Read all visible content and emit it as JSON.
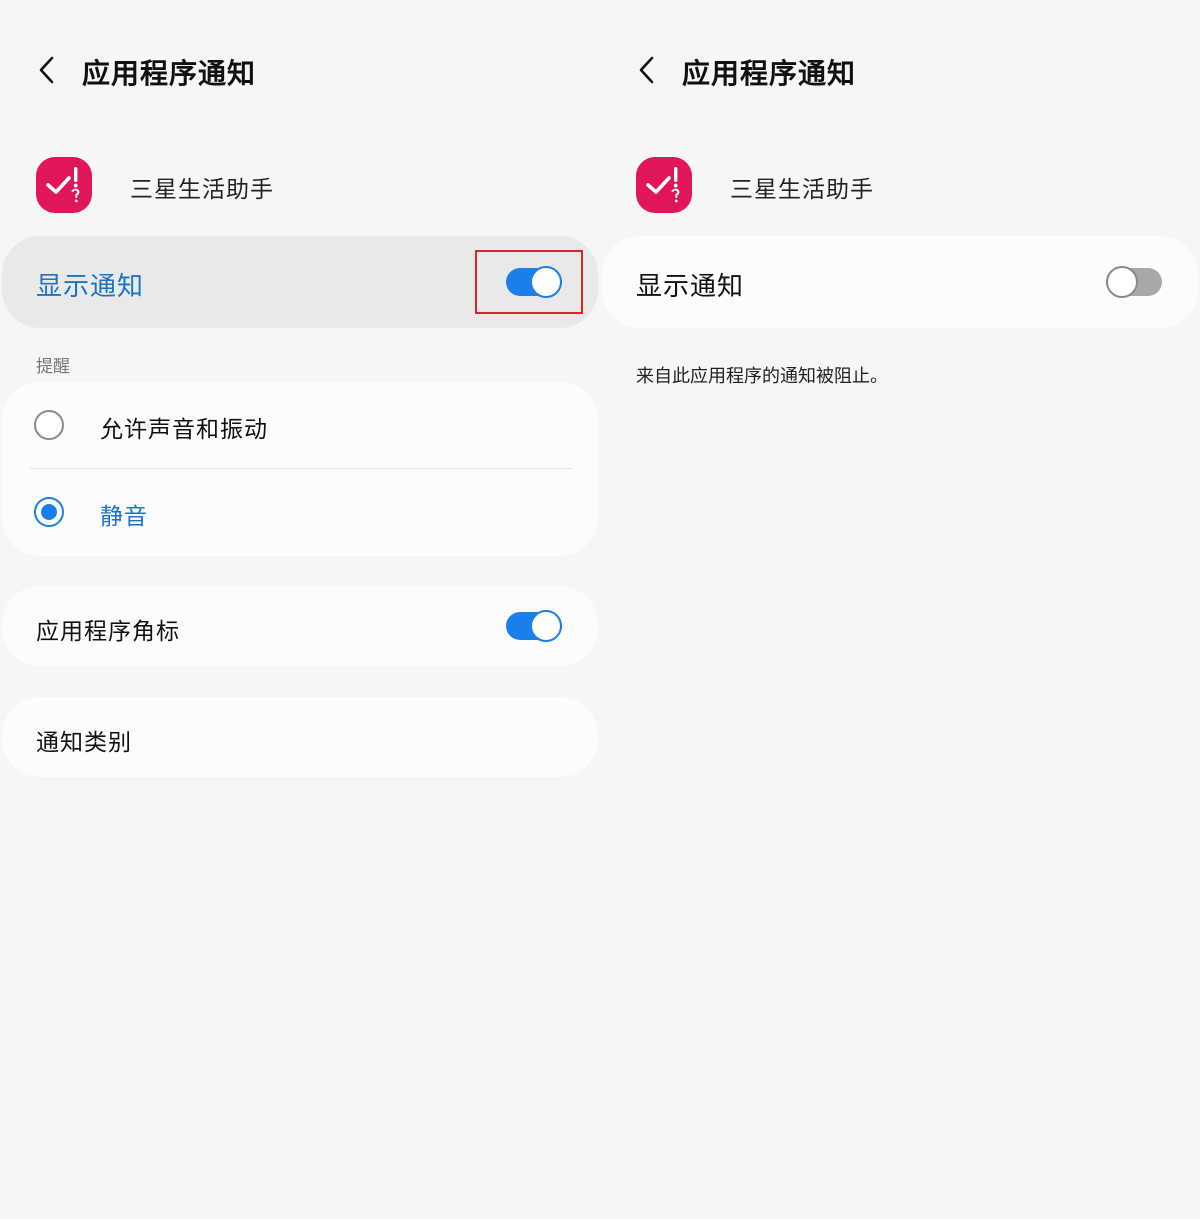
{
  "left": {
    "title": "应用程序通知",
    "app_name": "三星生活助手",
    "show_notifications": {
      "label": "显示通知",
      "enabled": true
    },
    "section_label": "提醒",
    "alert_options": [
      {
        "label": "允许声音和振动",
        "selected": false
      },
      {
        "label": "静音",
        "selected": true
      }
    ],
    "badge": {
      "label": "应用程序角标",
      "enabled": true
    },
    "categories_label": "通知类别"
  },
  "right": {
    "title": "应用程序通知",
    "app_name": "三星生活助手",
    "show_notifications": {
      "label": "显示通知",
      "enabled": false
    },
    "blocked_message": "来自此应用程序的通知被阻止。"
  },
  "colors": {
    "accent": "#1a7fe8",
    "app_icon": "#e0155a",
    "highlight": "#d8262c",
    "background": "#f6f6f6"
  },
  "icons": {
    "back": "chevron-left-icon",
    "app": "check-exclamation-question-icon"
  }
}
